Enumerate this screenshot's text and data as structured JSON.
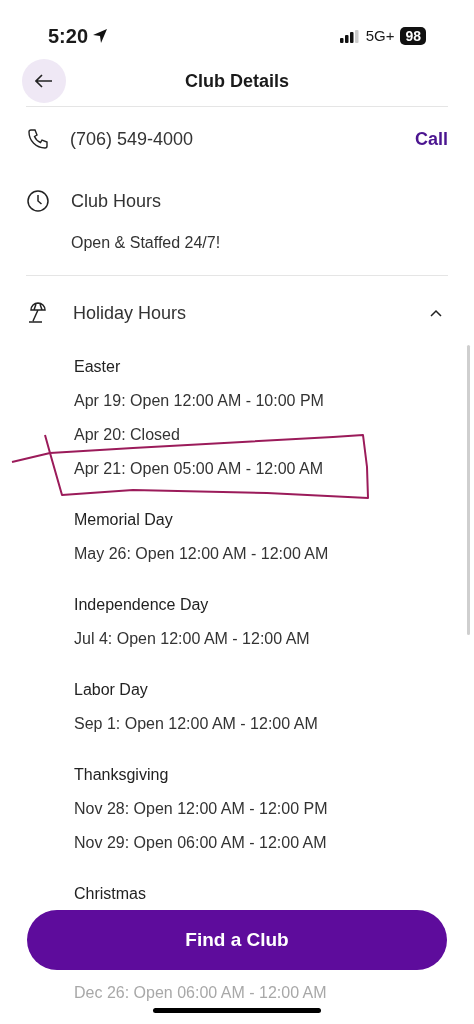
{
  "status_bar": {
    "time": "5:20",
    "network": "5G+",
    "battery": "98"
  },
  "header": {
    "title": "Club Details"
  },
  "phone": {
    "number": "(706) 549-4000",
    "action": "Call"
  },
  "club_hours": {
    "label": "Club Hours",
    "text": "Open & Staffed 24/7!"
  },
  "holiday_hours": {
    "label": "Holiday Hours",
    "expanded": true,
    "groups": [
      {
        "name": "Easter",
        "lines": [
          "Apr 19: Open 12:00 AM - 10:00 PM",
          "Apr 20: Closed",
          "Apr 21: Open 05:00 AM - 12:00 AM"
        ]
      },
      {
        "name": "Memorial Day",
        "lines": [
          "May 26: Open 12:00 AM - 12:00 AM"
        ]
      },
      {
        "name": "Independence Day",
        "lines": [
          "Jul 4: Open 12:00 AM - 12:00 AM"
        ]
      },
      {
        "name": "Labor Day",
        "lines": [
          "Sep 1: Open 12:00 AM - 12:00 AM"
        ]
      },
      {
        "name": "Thanksgiving",
        "lines": [
          "Nov 28: Open 12:00 AM - 12:00 PM",
          "Nov 29: Open 06:00 AM - 12:00 AM"
        ]
      },
      {
        "name": "Christmas",
        "lines": [
          "Dec 26: Open 06:00 AM - 12:00 AM"
        ]
      }
    ]
  },
  "button": {
    "label": "Find a Club"
  }
}
